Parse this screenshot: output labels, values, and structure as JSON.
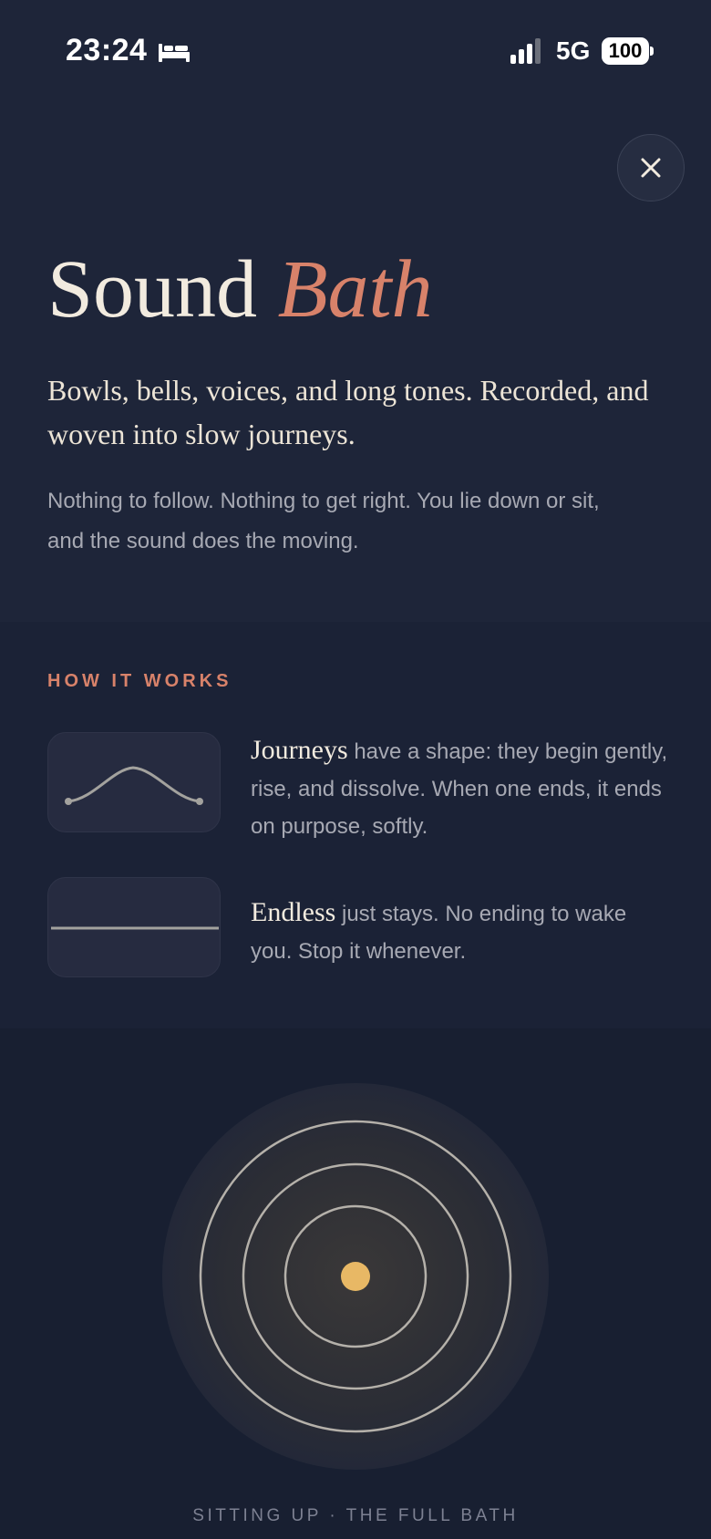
{
  "status_bar": {
    "time": "23:24",
    "focus_icon": "bed-icon",
    "network": "5G",
    "battery": "100"
  },
  "close_icon": "close-icon",
  "header": {
    "title_main": "Sound",
    "title_accent": "Bath",
    "tagline": "Bowls, bells, voices, and long tones. Recorded, and woven into slow journeys.",
    "lede": "Nothing to follow. Nothing to get right. You lie down or sit, and the sound does the moving."
  },
  "how_it_works": {
    "label": "HOW IT WORKS",
    "items": [
      {
        "term": "Journeys",
        "description": "have a shape: they begin gently, rise, and dissolve. When one ends, it ends on purpose, softly.",
        "icon": "curve-icon"
      },
      {
        "term": "Endless",
        "description": "just stays. No ending to wake you. Stop it whenever.",
        "icon": "flat-line-icon"
      }
    ]
  },
  "player": {
    "caption": "SITTING UP · THE FULL BATH"
  },
  "colors": {
    "background": "#1e2539",
    "accent": "#d8826a",
    "dot": "#e8b865",
    "text": "#f2ebdf"
  }
}
